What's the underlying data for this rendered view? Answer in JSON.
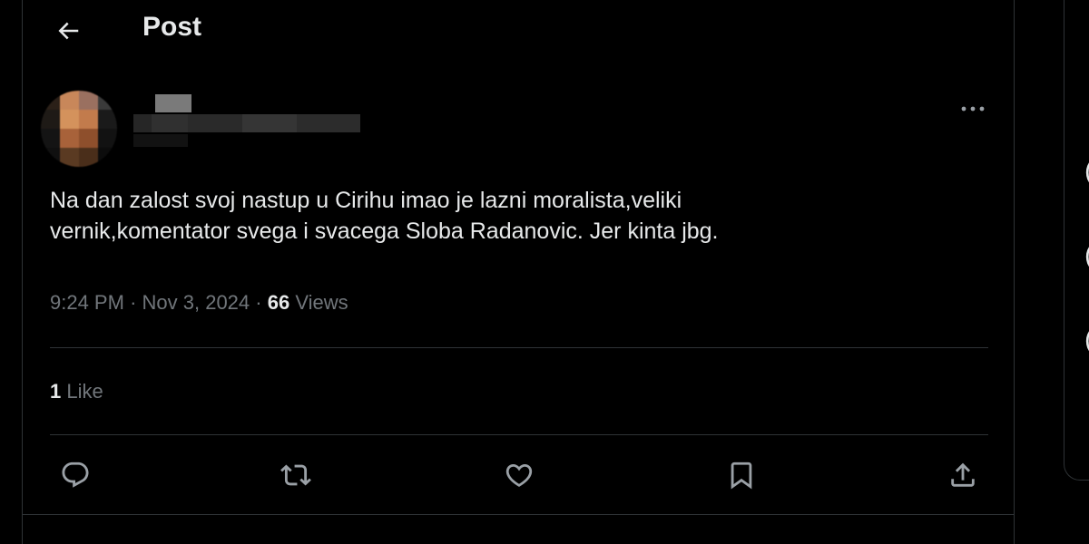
{
  "header": {
    "title": "Post",
    "back_icon": "arrow-left-icon"
  },
  "author": {
    "avatar_pixels": [
      "#2b2018",
      "#c8875a",
      "#9a7060",
      "#3a3a3a",
      "#1e1a16",
      "#d4925c",
      "#c27b4c",
      "#1a1a1a",
      "#141414",
      "#a8623a",
      "#8e4f2c",
      "#121212",
      "#101010",
      "#5a3a22",
      "#4a2e1a",
      "#0c0c0c"
    ]
  },
  "tweet": {
    "text_line1": "Na dan zalost svoj nastup u Cirihu imao je lazni moralista,veliki",
    "text_line2": "vernik,komentator svega i svacega Sloba Radanovic. Jer kinta jbg.",
    "time": "9:24 PM",
    "date": "Nov 3, 2024",
    "views_count": "66",
    "views_label": "Views",
    "separator": "·"
  },
  "stats": {
    "like_count": "1",
    "like_label": "Like"
  },
  "actions": [
    "reply-icon",
    "retweet-icon",
    "like-icon",
    "bookmark-icon",
    "share-icon"
  ],
  "colors": {
    "background": "#000000",
    "text": "#e7e9ea",
    "secondary": "#71767b",
    "border": "#2f3336"
  }
}
